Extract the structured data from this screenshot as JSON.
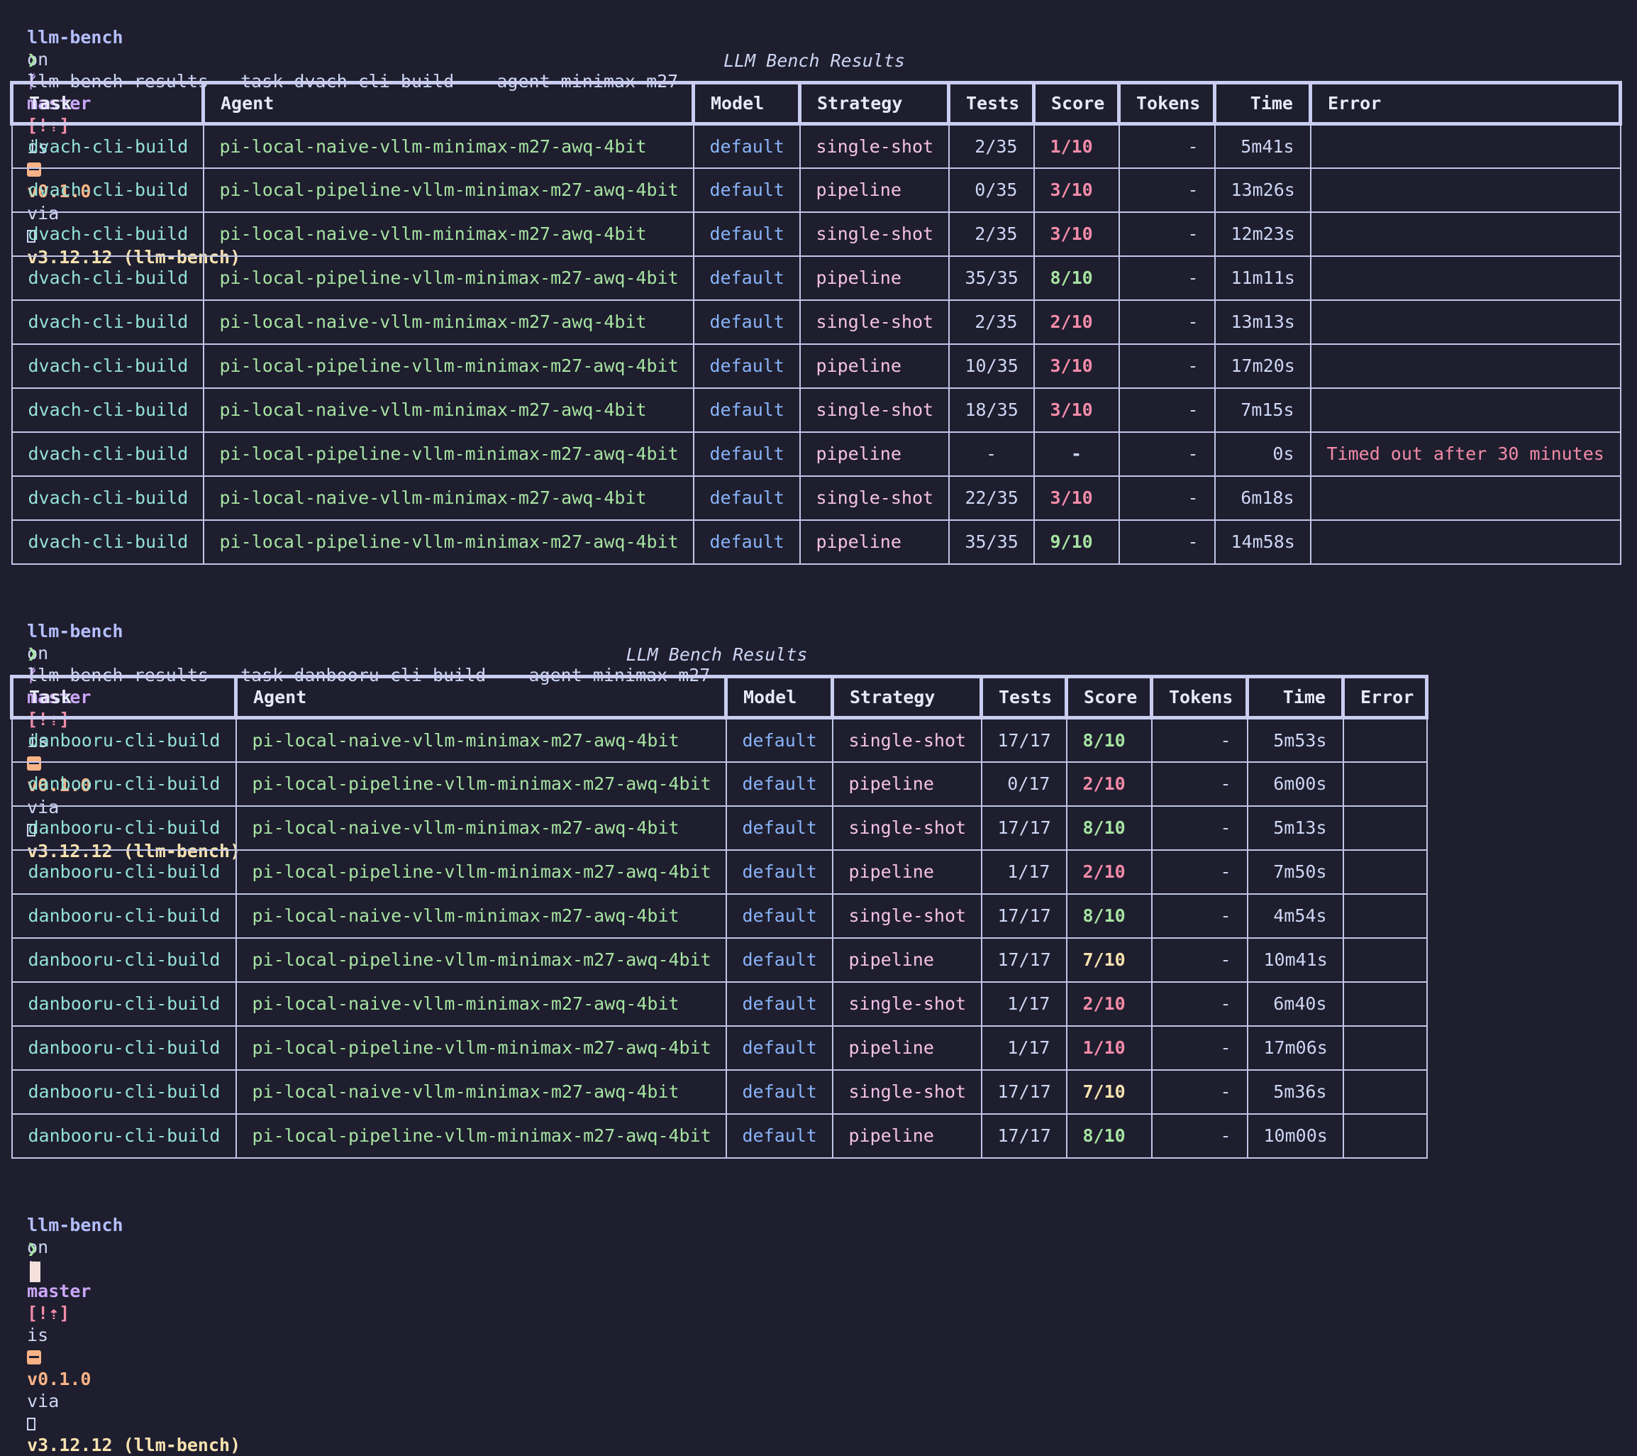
{
  "prompt": {
    "dir": "llm-bench",
    "on": "on",
    "branch_icon": "git-branch-icon",
    "branch_glyph": "ᚠ",
    "branch": "master",
    "status": "[!⇡]",
    "is": "is",
    "package_icon": "package-icon",
    "version": "v0.1.0",
    "via": "via",
    "python_icon": "python-icon",
    "python": "v3.12.12 (llm-bench)",
    "arrow": "❯"
  },
  "colors": {
    "background": "#1e1e2e",
    "score_low": "#f38ba8",
    "score_mid": "#f9e2af",
    "score_high": "#a6e3a1",
    "error": "#f38ba8"
  },
  "blocks": [
    {
      "command": "llm-bench results --task dvach-cli-build  --agent minimax-m27",
      "caption": "LLM Bench Results",
      "headers": [
        "Task",
        "Agent",
        "Model",
        "Strategy",
        "Tests",
        "Score",
        "Tokens",
        "Time",
        "Error"
      ],
      "rows": [
        {
          "task": "dvach-cli-build",
          "agent": "pi-local-naive-vllm-minimax-m27-awq-4bit",
          "model": "default",
          "strategy": "single-shot",
          "tests": "2/35",
          "score": "1/10",
          "score_level": "low",
          "tokens": "-",
          "time": "5m41s",
          "error": ""
        },
        {
          "task": "dvach-cli-build",
          "agent": "pi-local-pipeline-vllm-minimax-m27-awq-4bit",
          "model": "default",
          "strategy": "pipeline",
          "tests": "0/35",
          "score": "3/10",
          "score_level": "low",
          "tokens": "-",
          "time": "13m26s",
          "error": ""
        },
        {
          "task": "dvach-cli-build",
          "agent": "pi-local-naive-vllm-minimax-m27-awq-4bit",
          "model": "default",
          "strategy": "single-shot",
          "tests": "2/35",
          "score": "3/10",
          "score_level": "low",
          "tokens": "-",
          "time": "12m23s",
          "error": ""
        },
        {
          "task": "dvach-cli-build",
          "agent": "pi-local-pipeline-vllm-minimax-m27-awq-4bit",
          "model": "default",
          "strategy": "pipeline",
          "tests": "35/35",
          "score": "8/10",
          "score_level": "high",
          "tokens": "-",
          "time": "11m11s",
          "error": ""
        },
        {
          "task": "dvach-cli-build",
          "agent": "pi-local-naive-vllm-minimax-m27-awq-4bit",
          "model": "default",
          "strategy": "single-shot",
          "tests": "2/35",
          "score": "2/10",
          "score_level": "low",
          "tokens": "-",
          "time": "13m13s",
          "error": ""
        },
        {
          "task": "dvach-cli-build",
          "agent": "pi-local-pipeline-vllm-minimax-m27-awq-4bit",
          "model": "default",
          "strategy": "pipeline",
          "tests": "10/35",
          "score": "3/10",
          "score_level": "low",
          "tokens": "-",
          "time": "17m20s",
          "error": ""
        },
        {
          "task": "dvach-cli-build",
          "agent": "pi-local-naive-vllm-minimax-m27-awq-4bit",
          "model": "default",
          "strategy": "single-shot",
          "tests": "18/35",
          "score": "3/10",
          "score_level": "low",
          "tokens": "-",
          "time": "7m15s",
          "error": ""
        },
        {
          "task": "dvach-cli-build",
          "agent": "pi-local-pipeline-vllm-minimax-m27-awq-4bit",
          "model": "default",
          "strategy": "pipeline",
          "tests": "-",
          "score": "-",
          "score_level": "none",
          "tokens": "-",
          "time": "0s",
          "error": "Timed out after 30 minutes"
        },
        {
          "task": "dvach-cli-build",
          "agent": "pi-local-naive-vllm-minimax-m27-awq-4bit",
          "model": "default",
          "strategy": "single-shot",
          "tests": "22/35",
          "score": "3/10",
          "score_level": "low",
          "tokens": "-",
          "time": "6m18s",
          "error": ""
        },
        {
          "task": "dvach-cli-build",
          "agent": "pi-local-pipeline-vllm-minimax-m27-awq-4bit",
          "model": "default",
          "strategy": "pipeline",
          "tests": "35/35",
          "score": "9/10",
          "score_level": "high",
          "tokens": "-",
          "time": "14m58s",
          "error": ""
        }
      ]
    },
    {
      "command": "llm-bench results --task danbooru-cli-build  --agent minimax-m27",
      "caption": "LLM Bench Results",
      "headers": [
        "Task",
        "Agent",
        "Model",
        "Strategy",
        "Tests",
        "Score",
        "Tokens",
        "Time",
        "Error"
      ],
      "rows": [
        {
          "task": "danbooru-cli-build",
          "agent": "pi-local-naive-vllm-minimax-m27-awq-4bit",
          "model": "default",
          "strategy": "single-shot",
          "tests": "17/17",
          "score": "8/10",
          "score_level": "high",
          "tokens": "-",
          "time": "5m53s",
          "error": ""
        },
        {
          "task": "danbooru-cli-build",
          "agent": "pi-local-pipeline-vllm-minimax-m27-awq-4bit",
          "model": "default",
          "strategy": "pipeline",
          "tests": "0/17",
          "score": "2/10",
          "score_level": "low",
          "tokens": "-",
          "time": "6m00s",
          "error": ""
        },
        {
          "task": "danbooru-cli-build",
          "agent": "pi-local-naive-vllm-minimax-m27-awq-4bit",
          "model": "default",
          "strategy": "single-shot",
          "tests": "17/17",
          "score": "8/10",
          "score_level": "high",
          "tokens": "-",
          "time": "5m13s",
          "error": ""
        },
        {
          "task": "danbooru-cli-build",
          "agent": "pi-local-pipeline-vllm-minimax-m27-awq-4bit",
          "model": "default",
          "strategy": "pipeline",
          "tests": "1/17",
          "score": "2/10",
          "score_level": "low",
          "tokens": "-",
          "time": "7m50s",
          "error": ""
        },
        {
          "task": "danbooru-cli-build",
          "agent": "pi-local-naive-vllm-minimax-m27-awq-4bit",
          "model": "default",
          "strategy": "single-shot",
          "tests": "17/17",
          "score": "8/10",
          "score_level": "high",
          "tokens": "-",
          "time": "4m54s",
          "error": ""
        },
        {
          "task": "danbooru-cli-build",
          "agent": "pi-local-pipeline-vllm-minimax-m27-awq-4bit",
          "model": "default",
          "strategy": "pipeline",
          "tests": "17/17",
          "score": "7/10",
          "score_level": "mid",
          "tokens": "-",
          "time": "10m41s",
          "error": ""
        },
        {
          "task": "danbooru-cli-build",
          "agent": "pi-local-naive-vllm-minimax-m27-awq-4bit",
          "model": "default",
          "strategy": "single-shot",
          "tests": "1/17",
          "score": "2/10",
          "score_level": "low",
          "tokens": "-",
          "time": "6m40s",
          "error": ""
        },
        {
          "task": "danbooru-cli-build",
          "agent": "pi-local-pipeline-vllm-minimax-m27-awq-4bit",
          "model": "default",
          "strategy": "pipeline",
          "tests": "1/17",
          "score": "1/10",
          "score_level": "low",
          "tokens": "-",
          "time": "17m06s",
          "error": ""
        },
        {
          "task": "danbooru-cli-build",
          "agent": "pi-local-naive-vllm-minimax-m27-awq-4bit",
          "model": "default",
          "strategy": "single-shot",
          "tests": "17/17",
          "score": "7/10",
          "score_level": "mid",
          "tokens": "-",
          "time": "5m36s",
          "error": ""
        },
        {
          "task": "danbooru-cli-build",
          "agent": "pi-local-pipeline-vllm-minimax-m27-awq-4bit",
          "model": "default",
          "strategy": "pipeline",
          "tests": "17/17",
          "score": "8/10",
          "score_level": "high",
          "tokens": "-",
          "time": "10m00s",
          "error": ""
        }
      ]
    }
  ]
}
